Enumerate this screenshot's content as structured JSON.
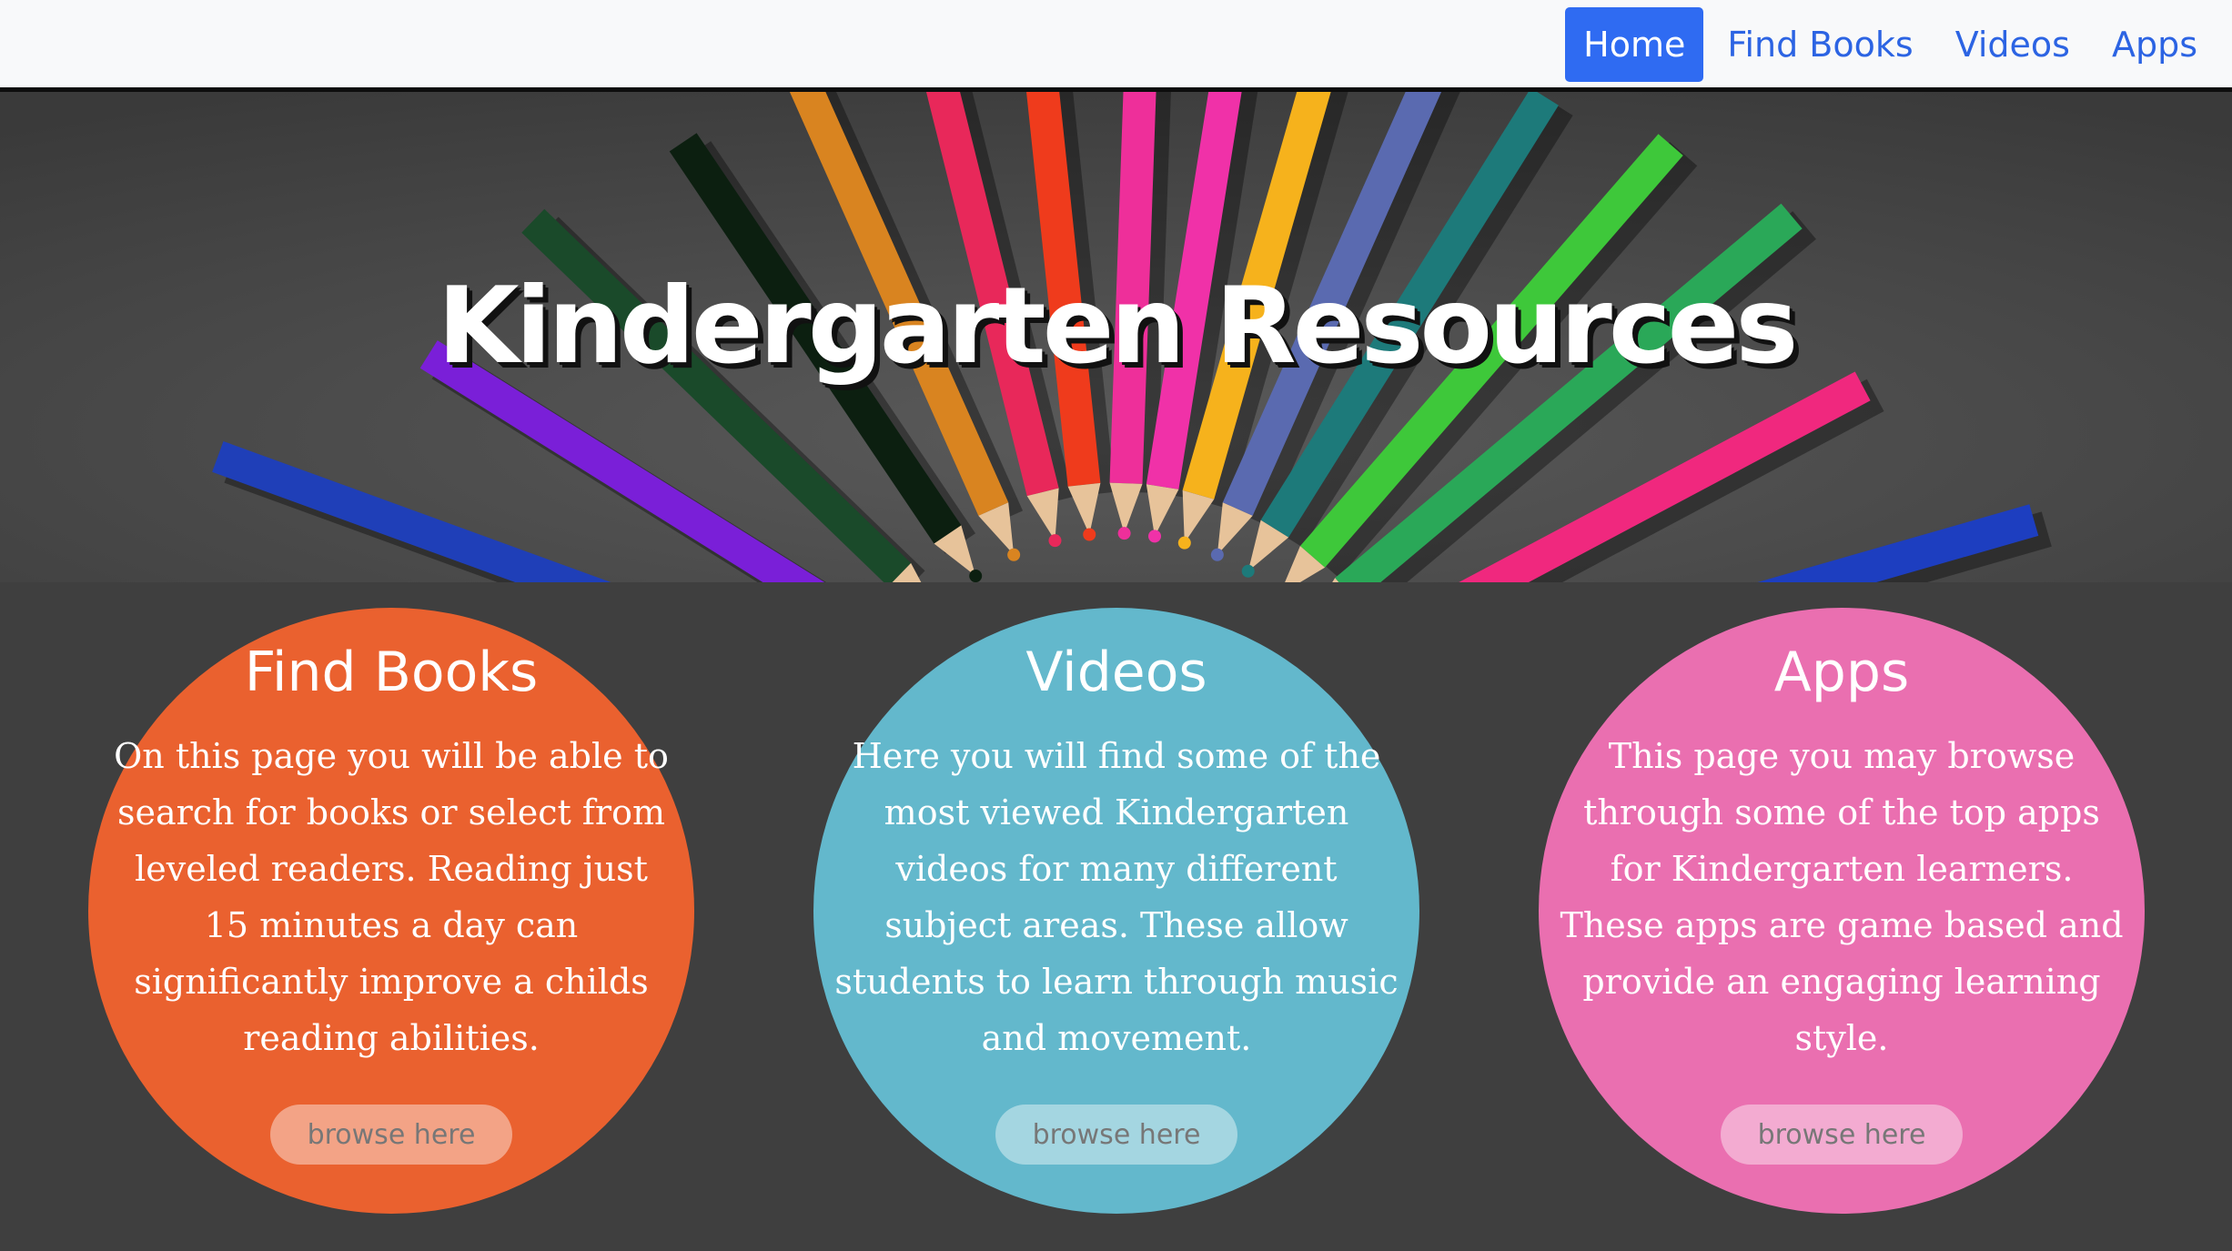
{
  "nav": {
    "items": [
      {
        "label": "Home",
        "active": true
      },
      {
        "label": "Find Books",
        "active": false
      },
      {
        "label": "Videos",
        "active": false
      },
      {
        "label": "Apps",
        "active": false
      }
    ],
    "accent_color": "#2f6bf2"
  },
  "hero": {
    "title": "Kindergarten Resources",
    "background_image": "colored-pencils-fan"
  },
  "cards": [
    {
      "title": "Find Books",
      "text": "On this page you will be able to search for books or select from leveled readers. Reading just 15 minutes a day can significantly improve a childs reading abilities.",
      "button_label": "browse here",
      "color": "#ea612f"
    },
    {
      "title": "Videos",
      "text": "Here you will find some of the most viewed Kindergarten videos for many different subject areas. These allow students to learn through music and movement.",
      "button_label": "browse here",
      "color": "#63b8cc"
    },
    {
      "title": "Apps",
      "text": "This page you may browse through some of the top apps for Kindergarten learners. These apps are game based and provide an engaging learning style.",
      "button_label": "browse here",
      "color": "#ea6fb0"
    }
  ],
  "page_background_color": "#3f3f3f"
}
